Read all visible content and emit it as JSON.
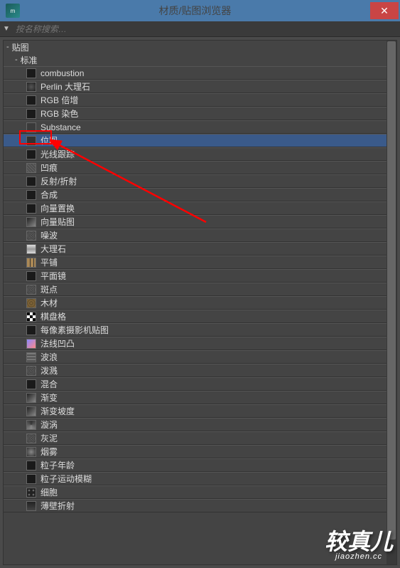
{
  "window": {
    "title": "材质/贴图浏览器",
    "close": "✕",
    "app_icon": "m"
  },
  "toolbar": {
    "dropdown": "▼",
    "search_placeholder": "按名称搜索…"
  },
  "groups": {
    "root_label": "贴图",
    "sub_label": "标准",
    "collapse": "-"
  },
  "items": [
    {
      "label": "combustion",
      "thumb": "black"
    },
    {
      "label": "Perlin 大理石",
      "thumb": "perlin"
    },
    {
      "label": "RGB 倍增",
      "thumb": "black"
    },
    {
      "label": "RGB 染色",
      "thumb": "black"
    },
    {
      "label": "Substance",
      "thumb": "substance"
    },
    {
      "label": "位图",
      "thumb": "bitmap",
      "selected": true,
      "highlighted": true
    },
    {
      "label": "光线跟踪",
      "thumb": "black"
    },
    {
      "label": "凹痕",
      "thumb": "dent"
    },
    {
      "label": "反射/折射",
      "thumb": "black"
    },
    {
      "label": "合成",
      "thumb": "black"
    },
    {
      "label": "向量置换",
      "thumb": "black"
    },
    {
      "label": "向量贴图",
      "thumb": "gradient"
    },
    {
      "label": "噪波",
      "thumb": "noise"
    },
    {
      "label": "大理石",
      "thumb": "marble"
    },
    {
      "label": "平铺",
      "thumb": "tile"
    },
    {
      "label": "平面镜",
      "thumb": "black"
    },
    {
      "label": "斑点",
      "thumb": "noise"
    },
    {
      "label": "木材",
      "thumb": "wood"
    },
    {
      "label": "棋盘格",
      "thumb": "checker"
    },
    {
      "label": "每像素摄影机贴图",
      "thumb": "black"
    },
    {
      "label": "法线凹凸",
      "thumb": "normal"
    },
    {
      "label": "波浪",
      "thumb": "wave"
    },
    {
      "label": "泼溅",
      "thumb": "noise"
    },
    {
      "label": "混合",
      "thumb": "black"
    },
    {
      "label": "渐变",
      "thumb": "gradient"
    },
    {
      "label": "渐变坡度",
      "thumb": "gradient"
    },
    {
      "label": "漩涡",
      "thumb": "swirl"
    },
    {
      "label": "灰泥",
      "thumb": "noise"
    },
    {
      "label": "烟雾",
      "thumb": "smoke"
    },
    {
      "label": "粒子年龄",
      "thumb": "black"
    },
    {
      "label": "粒子运动模糊",
      "thumb": "black"
    },
    {
      "label": "细胞",
      "thumb": "cell"
    },
    {
      "label": "薄壁折射",
      "thumb": "thin"
    }
  ],
  "watermark": {
    "main": "较真儿",
    "sub": "jiaozhen.cc"
  }
}
